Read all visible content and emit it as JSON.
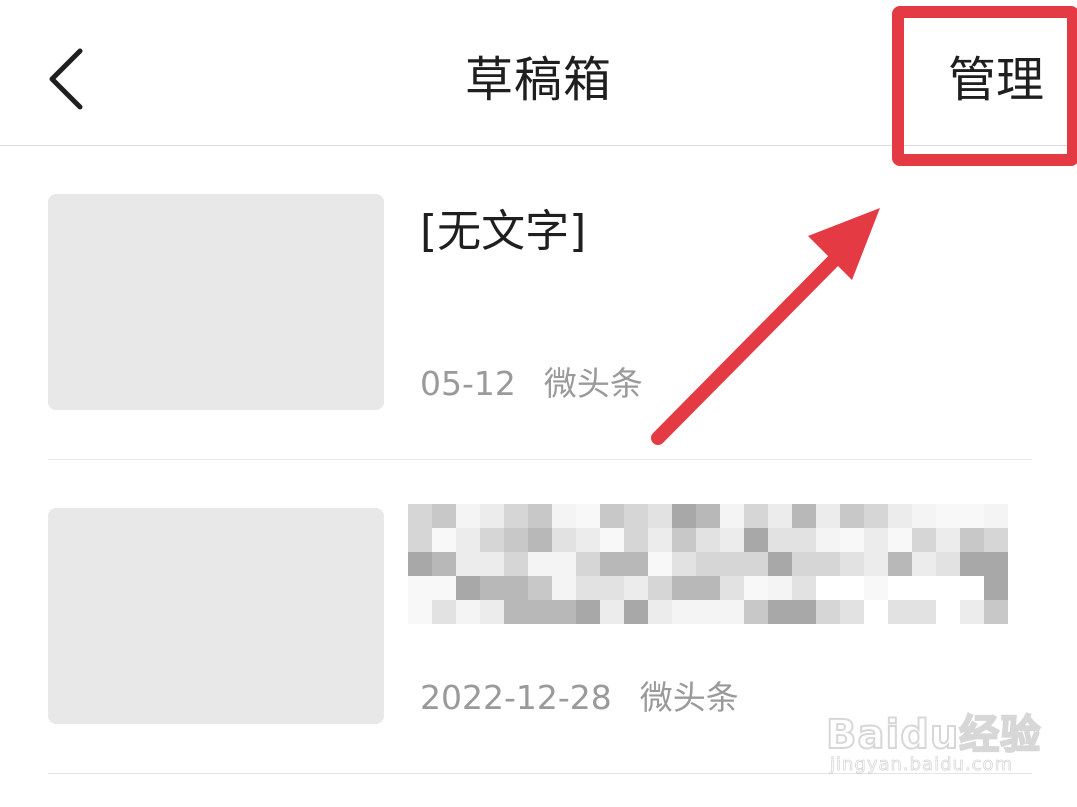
{
  "header": {
    "back_icon": "chevron-left-icon",
    "title": "草稿箱",
    "manage_label": "管理"
  },
  "drafts": [
    {
      "title": "[无文字]",
      "date": "05-12",
      "source": "微头条"
    },
    {
      "title": "",
      "title_obscured": true,
      "date": "2022-12-28",
      "source": "微头条"
    }
  ],
  "annotation": {
    "color": "#e33a43"
  },
  "watermark": {
    "main": "Baidu经验",
    "sub": "jingyan.baidu.com"
  },
  "colors": {
    "text_primary": "#1f1f1f",
    "text_secondary": "#9a9a9a",
    "thumbnail": "#e8e8e8",
    "divider": "#e6e6e6",
    "highlight": "#e33a43"
  }
}
